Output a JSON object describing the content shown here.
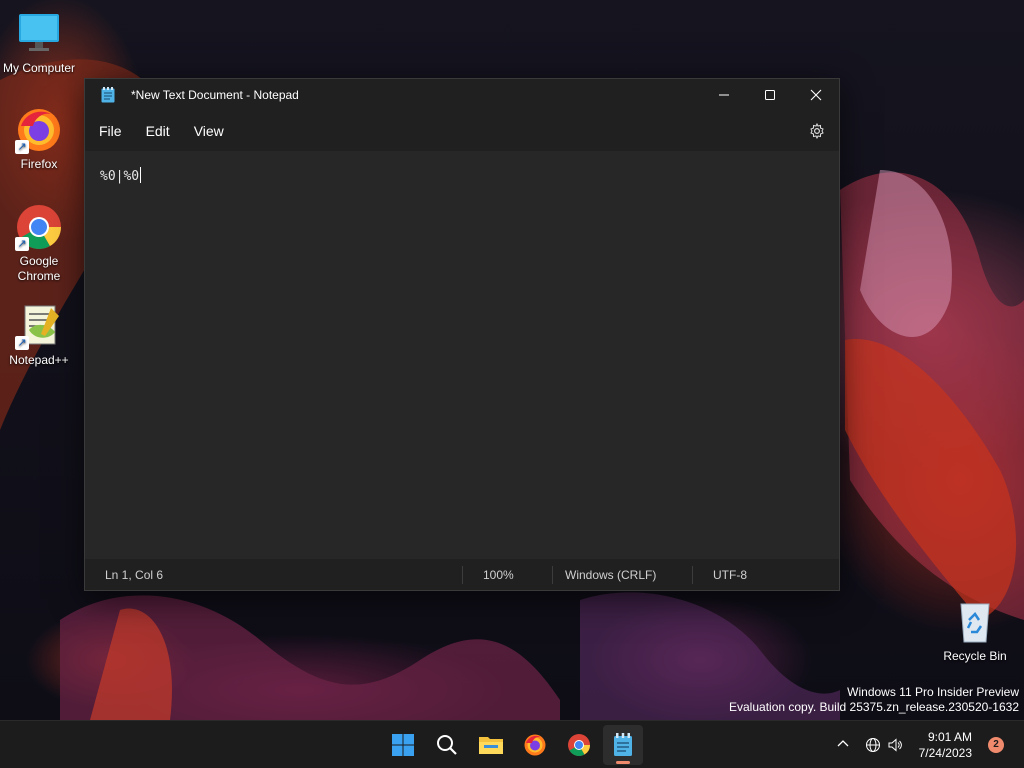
{
  "desktop": {
    "icons": [
      {
        "label": "My Computer",
        "icon": "monitor-icon"
      },
      {
        "label": "Firefox",
        "icon": "firefox-icon"
      },
      {
        "label": "Google Chrome",
        "icon": "chrome-icon"
      },
      {
        "label": "Notepad++",
        "icon": "notepadpp-icon"
      },
      {
        "label": "Recycle Bin",
        "icon": "recycle-bin-icon"
      }
    ]
  },
  "window": {
    "title": "*New Text Document - Notepad",
    "menu": [
      "File",
      "Edit",
      "View"
    ],
    "content": "%0|%0",
    "status": {
      "position": "Ln 1, Col 6",
      "zoom": "100%",
      "line_ending": "Windows (CRLF)",
      "encoding": "UTF-8"
    }
  },
  "watermark": {
    "line1": "Windows 11 Pro Insider Preview",
    "line2": "Evaluation copy. Build 25375.zn_release.230520-1632"
  },
  "taskbar": {
    "apps": [
      "start-icon",
      "search-icon",
      "file-explorer-icon",
      "firefox-icon",
      "chrome-icon",
      "notepad-icon"
    ],
    "active_app": "notepad-icon",
    "time": "9:01 AM",
    "date": "7/24/2023",
    "notification_count": "2"
  },
  "colors": {
    "accent": "#f08a6c",
    "window_bg": "#202020",
    "editor_bg": "#272727"
  }
}
